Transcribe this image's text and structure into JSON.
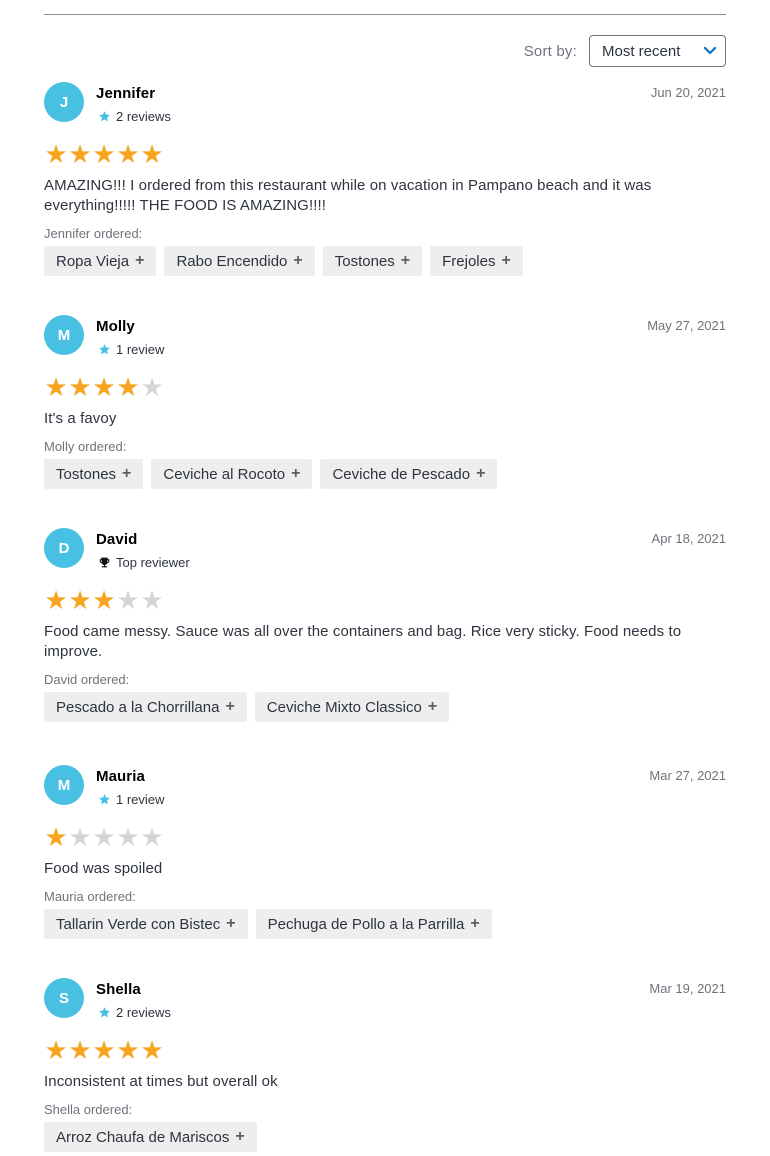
{
  "sort": {
    "label": "Sort by:",
    "value": "Most recent"
  },
  "colors": {
    "avatar": "#47c0e2",
    "star_on": "#f8a41e",
    "star_off": "#d6d6d6",
    "chip_bg": "#eeeeee"
  },
  "reviews": [
    {
      "initial": "J",
      "name": "Jennifer",
      "date": "Jun 20, 2021",
      "meta_icon": "star-icon",
      "meta": "2 reviews",
      "rating": 5,
      "text": "AMAZING!!! I ordered from this restaurant while on vacation in Pampano beach and it was everything!!!!! THE FOOD IS AMAZING!!!!",
      "ordered_label": "Jennifer ordered:",
      "items": [
        "Ropa Vieja",
        "Rabo Encendido",
        "Tostones",
        "Frejoles"
      ]
    },
    {
      "initial": "M",
      "name": "Molly",
      "date": "May 27, 2021",
      "meta_icon": "star-icon",
      "meta": "1 review",
      "rating": 4,
      "text": "It's a favoy",
      "ordered_label": "Molly ordered:",
      "items": [
        "Tostones",
        "Ceviche al Rocoto",
        "Ceviche de Pescado"
      ]
    },
    {
      "initial": "D",
      "name": "David",
      "date": "Apr 18, 2021",
      "meta_icon": "trophy-icon",
      "meta": "Top reviewer",
      "rating": 3,
      "text": "Food came messy. Sauce was all over the containers and bag. Rice very sticky. Food needs to improve.",
      "ordered_label": "David ordered:",
      "items": [
        "Pescado a la Chorrillana",
        "Ceviche Mixto Classico"
      ]
    },
    {
      "initial": "M",
      "name": "Mauria",
      "date": "Mar 27, 2021",
      "meta_icon": "star-icon",
      "meta": "1 review",
      "rating": 1,
      "text": "Food was spoiled",
      "ordered_label": "Mauria ordered:",
      "items": [
        "Tallarin Verde con Bistec",
        "Pechuga de Pollo a la Parrilla"
      ]
    },
    {
      "initial": "S",
      "name": "Shella",
      "date": "Mar 19, 2021",
      "meta_icon": "star-icon",
      "meta": "2 reviews",
      "rating": 5,
      "text": "Inconsistent at times but overall ok",
      "ordered_label": "Shella ordered:",
      "items": [
        "Arroz Chaufa de Mariscos"
      ]
    }
  ]
}
